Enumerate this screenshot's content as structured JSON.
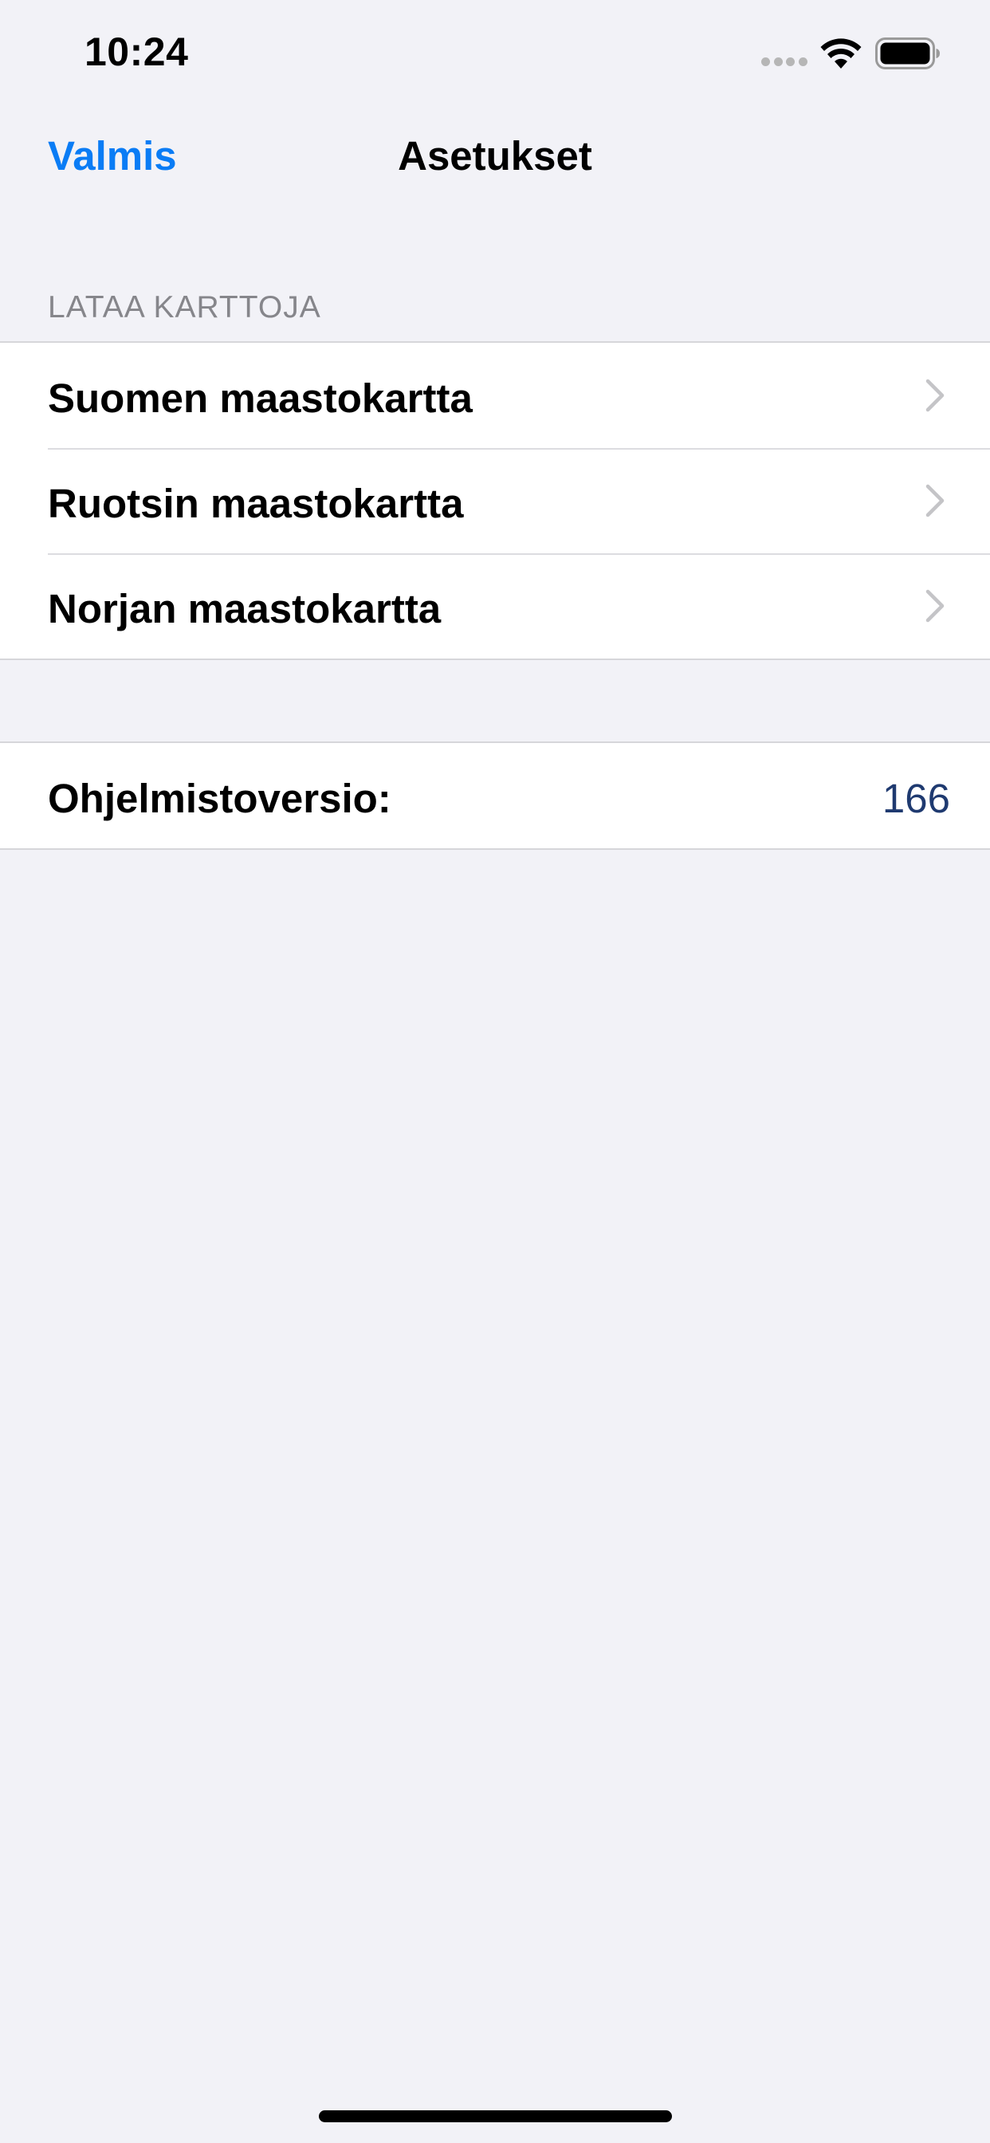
{
  "status_bar": {
    "time": "10:24"
  },
  "nav": {
    "done_label": "Valmis",
    "title": "Asetukset"
  },
  "maps_section": {
    "header": "LATAA KARTTOJA",
    "items": [
      {
        "label": "Suomen maastokartta"
      },
      {
        "label": "Ruotsin maastokartta"
      },
      {
        "label": "Norjan maastokartta"
      }
    ]
  },
  "version_section": {
    "label": "Ohjelmistoversio:",
    "value": "166"
  },
  "colors": {
    "accent": "#0a7cf5",
    "background": "#f2f2f7",
    "version_value": "#1f3a70",
    "section_header": "#86868b"
  },
  "icons": {
    "row_disclosure": "chevron-right-icon",
    "wifi": "wifi-icon",
    "battery": "battery-icon",
    "signal": "cellular-signal-icon"
  }
}
